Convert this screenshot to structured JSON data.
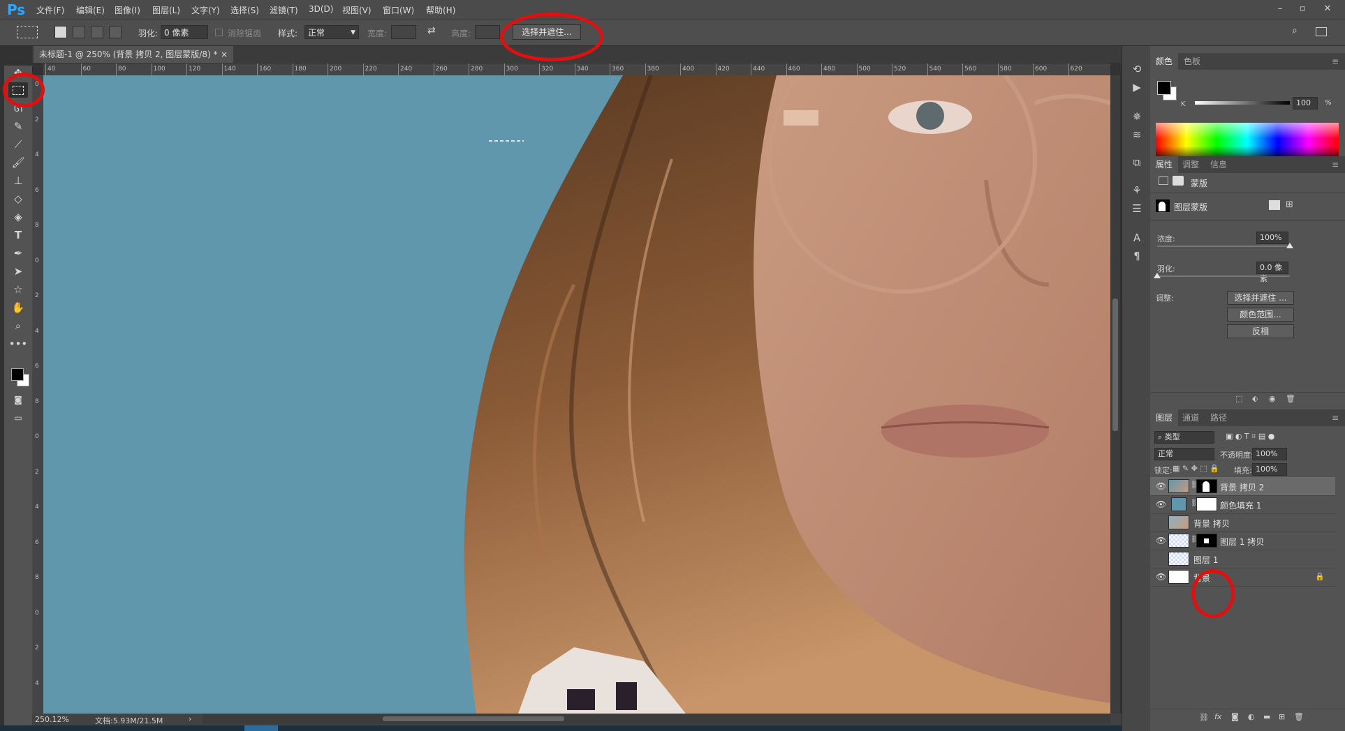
{
  "app": {
    "logo": "Ps"
  },
  "menu": [
    "文件(F)",
    "编辑(E)",
    "图像(I)",
    "图层(L)",
    "文字(Y)",
    "选择(S)",
    "滤镜(T)",
    "3D(D)",
    "视图(V)",
    "窗口(W)",
    "帮助(H)"
  ],
  "window_controls": {
    "minimize": "–",
    "restore": "▫",
    "close": "✕"
  },
  "options": {
    "feather_label": "羽化:",
    "feather_value": "0 像素",
    "antialias_label": "消除锯齿",
    "style_label": "样式:",
    "style_value": "正常",
    "width_label": "宽度:",
    "height_label": "高度:",
    "select_mask_button": "选择并遮住..."
  },
  "document": {
    "tab_title": "未标题-1 @ 250% (背景 拷贝 2, 图层蒙版/8) *",
    "tab_close": "×"
  },
  "ruler": {
    "h_ticks": [
      "40",
      "60",
      "80",
      "100",
      "120",
      "140",
      "160",
      "180",
      "200",
      "220",
      "240",
      "260",
      "280",
      "300",
      "320",
      "340",
      "360",
      "380",
      "400",
      "420",
      "440",
      "460",
      "480",
      "500",
      "520",
      "540",
      "560",
      "580",
      "600",
      "620"
    ],
    "v_ticks": [
      "0",
      "2",
      "4",
      "6",
      "8",
      "0",
      "2",
      "4",
      "6",
      "8",
      "0",
      "2",
      "4",
      "6",
      "8",
      "0",
      "2",
      "4"
    ]
  },
  "status": {
    "zoom": "250.12%",
    "doc": "文档:5.93M/21.5M"
  },
  "color_panel": {
    "tabs": [
      "颜色",
      "色板"
    ],
    "channel_label": "K",
    "value": "100",
    "unit": "%",
    "foreground": "#000000",
    "background": "#ffffff"
  },
  "properties_panel": {
    "tabs": [
      "属性",
      "调整",
      "信息"
    ],
    "mask_header": "蒙版",
    "layer_mask_label": "图层蒙版",
    "density_label": "浓度:",
    "density_value": "100%",
    "density_level": 1.0,
    "feather_label": "羽化:",
    "feather_value": "0.0 像素",
    "feather_level": 0.0,
    "adjust_label": "调整:",
    "buttons": [
      "选择并遮住 ...",
      "颜色范围...",
      "反相"
    ]
  },
  "layers_panel": {
    "tabs": [
      "图层",
      "通道",
      "路径"
    ],
    "filter_label": "类型",
    "blend_mode": "正常",
    "opacity_label": "不透明度:",
    "opacity_value": "100%",
    "lock_label": "锁定:",
    "fill_label": "填充:",
    "fill_value": "100%",
    "layers": [
      {
        "name": "背景 拷贝 2",
        "visible": true,
        "selected": true
      },
      {
        "name": "颜色填充 1",
        "visible": true,
        "selected": false
      },
      {
        "name": "背景 拷贝",
        "visible": false,
        "selected": false
      },
      {
        "name": "图层 1 拷贝",
        "visible": true,
        "selected": false
      },
      {
        "name": "图层 1",
        "visible": false,
        "selected": false
      },
      {
        "name": "背景",
        "visible": true,
        "selected": false
      }
    ],
    "footer_icons": [
      "link-icon",
      "fx-icon",
      "mask-icon",
      "adjustment-icon",
      "folder-icon",
      "new-layer-icon",
      "trash-icon"
    ]
  },
  "colors": {
    "canvas_bg": "#6097ac",
    "annotation": "#e01010",
    "accent": "#31a8ff"
  }
}
